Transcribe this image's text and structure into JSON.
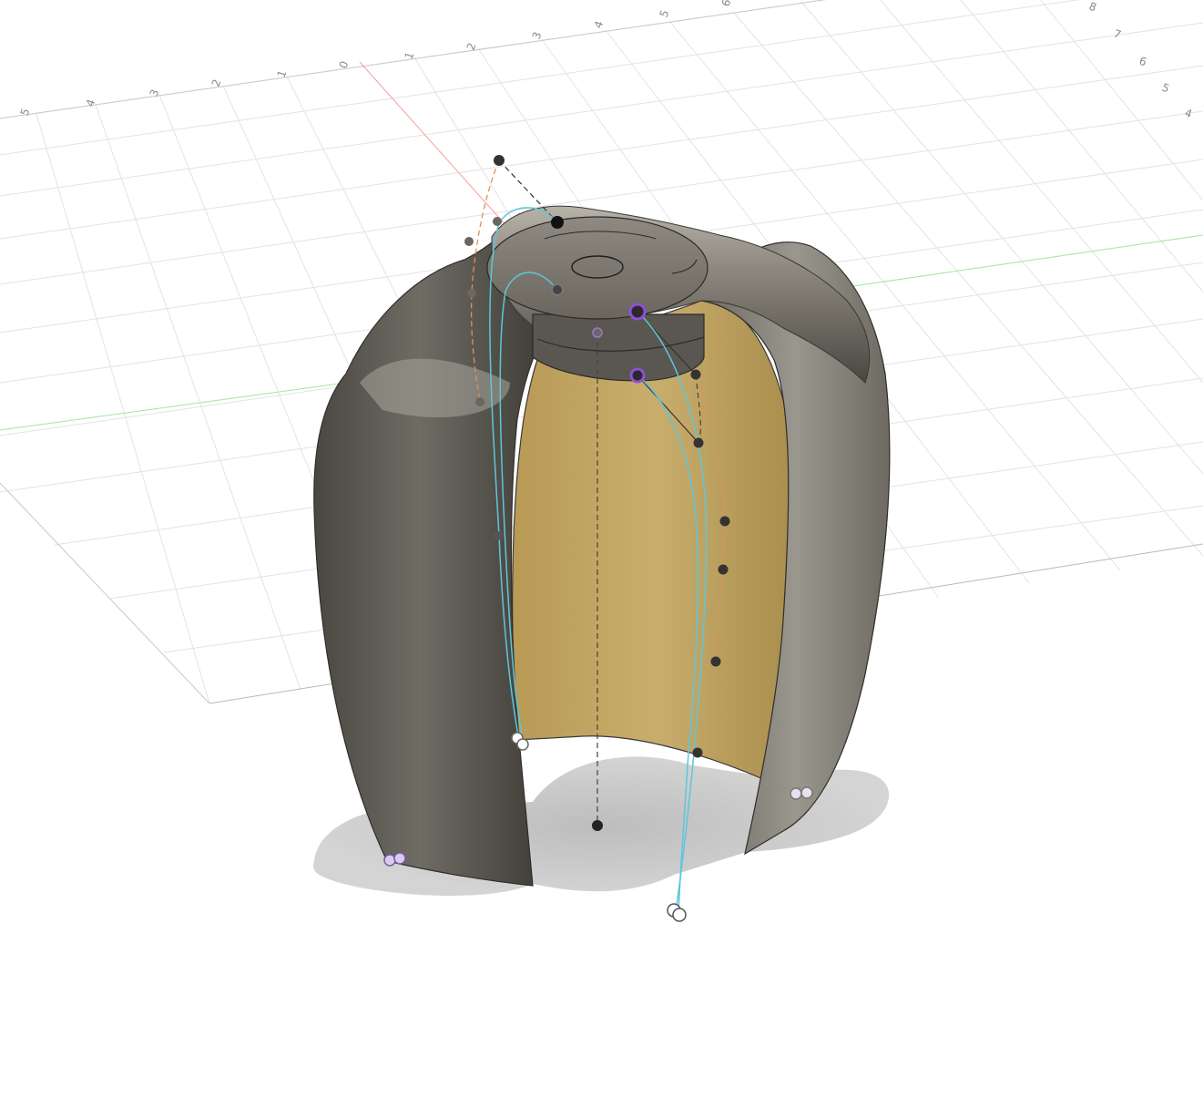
{
  "canvas": {
    "background": "#ffffff",
    "grid_color": "#dcdcdc",
    "x_axis_color": "#f08a8a",
    "y_axis_color": "#8fe08f"
  },
  "axis_labels": {
    "top": [
      "5",
      "4",
      "3",
      "2",
      "1",
      "0",
      "1",
      "2",
      "3",
      "4",
      "5",
      "6"
    ],
    "right": [
      "8",
      "7",
      "6",
      "5",
      "4"
    ]
  },
  "model": {
    "shell_color": "#5d5a53",
    "inner_face_color": "#c4a868",
    "spline_color": "#5ec6dc",
    "construction_line_color": "#e0915a",
    "selected_point_color": "#8e4fd6",
    "control_point_color": "#333333"
  }
}
